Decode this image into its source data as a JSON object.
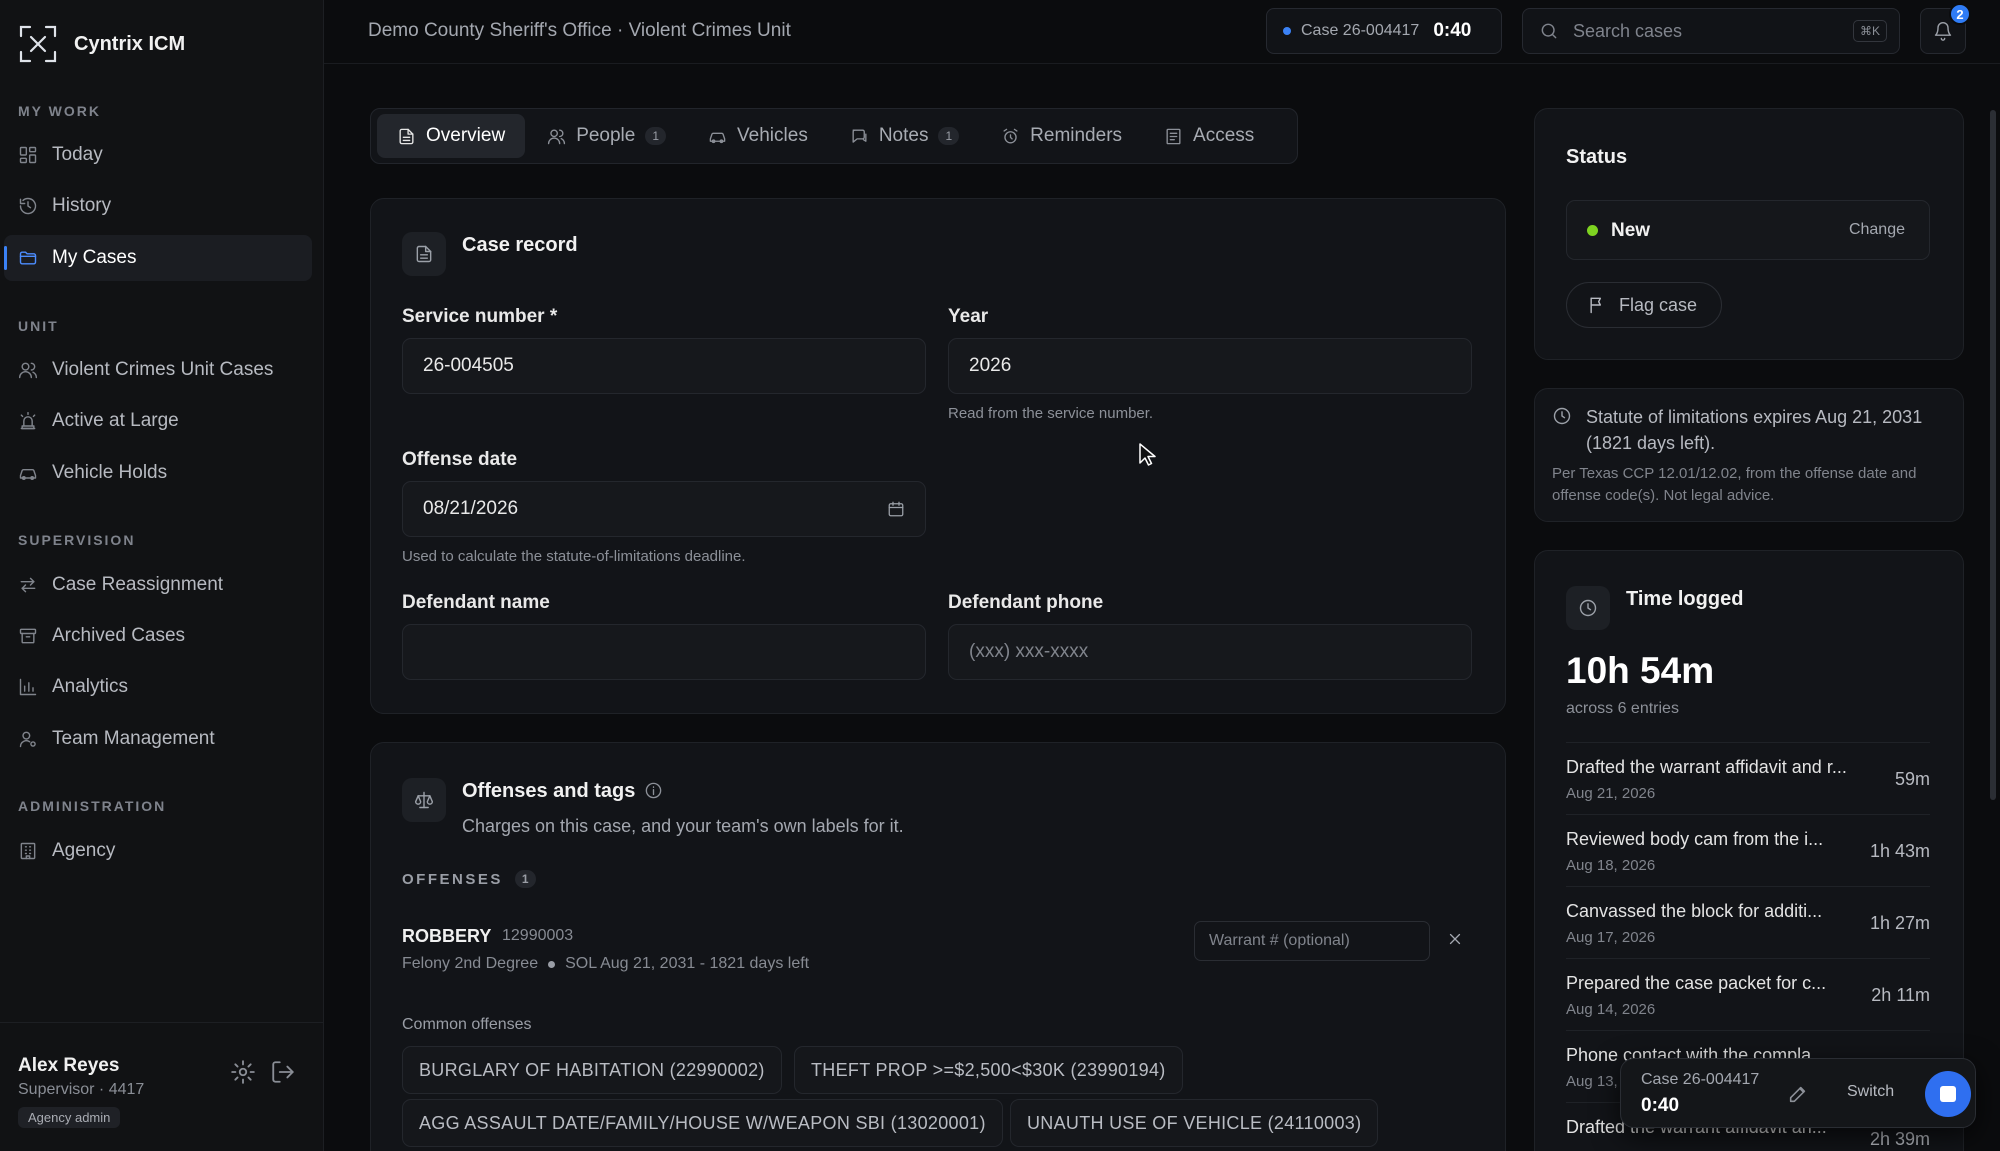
{
  "app": {
    "name": "Cyntrix ICM"
  },
  "sidebar": {
    "sections": {
      "my_work": "MY WORK",
      "unit": "UNIT",
      "supervision": "SUPERVISION",
      "administration": "ADMINISTRATION"
    },
    "items": [
      {
        "label": "Today",
        "icon": "grid-icon"
      },
      {
        "label": "History",
        "icon": "history-icon"
      },
      {
        "label": "My Cases",
        "icon": "folder-icon",
        "active": true
      },
      {
        "label": "Violent Crimes Unit Cases",
        "icon": "users-icon"
      },
      {
        "label": "Active at Large",
        "icon": "siren-icon"
      },
      {
        "label": "Vehicle Holds",
        "icon": "car-icon"
      },
      {
        "label": "Case Reassignment",
        "icon": "swap-icon"
      },
      {
        "label": "Archived Cases",
        "icon": "archive-icon"
      },
      {
        "label": "Analytics",
        "icon": "bar-chart-icon"
      },
      {
        "label": "Team Management",
        "icon": "user-gear-icon"
      },
      {
        "label": "Agency",
        "icon": "building-icon"
      }
    ],
    "user": {
      "name": "Alex Reyes",
      "role": "Supervisor · 4417",
      "badge": "Agency admin"
    }
  },
  "header": {
    "org": "Demo County Sheriff's Office · Violent Crimes Unit",
    "case_id": "Case 26-004417",
    "timer": "0:40",
    "search_placeholder": "Search cases",
    "search_shortcut": "⌘K",
    "notifications": "2"
  },
  "tabs": [
    {
      "label": "Overview",
      "icon": "document-icon",
      "active": true
    },
    {
      "label": "People",
      "icon": "people-icon",
      "count": "1"
    },
    {
      "label": "Vehicles",
      "icon": "car-icon"
    },
    {
      "label": "Notes",
      "icon": "chat-icon",
      "count": "1"
    },
    {
      "label": "Reminders",
      "icon": "alarm-icon"
    },
    {
      "label": "Access",
      "icon": "key-list-icon"
    }
  ],
  "case_record": {
    "title": "Case record",
    "service_number": {
      "label": "Service number *",
      "value": "26-004505"
    },
    "year": {
      "label": "Year",
      "value": "2026",
      "hint": "Read from the service number."
    },
    "offense_date": {
      "label": "Offense date",
      "value": "08/21/2026",
      "hint": "Used to calculate the statute-of-limitations deadline."
    },
    "defendant_name": {
      "label": "Defendant name",
      "value": ""
    },
    "defendant_phone": {
      "label": "Defendant phone",
      "placeholder": "(xxx) xxx-xxxx"
    }
  },
  "offenses": {
    "title": "Offenses and tags",
    "subtitle": "Charges on this case, and your team's own labels for it.",
    "section_label": "OFFENSES",
    "count": "1",
    "item": {
      "name": "ROBBERY",
      "code": "12990003",
      "degree": "Felony 2nd Degree",
      "sol": "SOL Aug 21, 2031 - 1821 days left",
      "warrant_placeholder": "Warrant # (optional)"
    },
    "common_label": "Common offenses",
    "common": [
      "BURGLARY OF HABITATION (22990002)",
      "THEFT PROP >=$2,500<$30K (23990194)",
      "AGG ASSAULT DATE/FAMILY/HOUSE W/WEAPON SBI (13020001)",
      "UNAUTH USE OF VEHICLE (24110003)"
    ]
  },
  "status": {
    "title": "Status",
    "value": "New",
    "change_label": "Change",
    "flag_label": "Flag case",
    "dot_color": "#7ed321"
  },
  "sol": {
    "main": "Statute of limitations expires Aug 21, 2031 (1821 days left).",
    "note": "Per Texas CCP 12.01/12.02, from the offense date and offense code(s). Not legal advice."
  },
  "time_logged": {
    "title": "Time logged",
    "total": "10h 54m",
    "sub": "across 6 entries",
    "entries": [
      {
        "desc": "Drafted the warrant affidavit and r...",
        "date": "Aug 21, 2026",
        "dur": "59m"
      },
      {
        "desc": "Reviewed body cam from the i...",
        "date": "Aug 18, 2026",
        "dur": "1h 43m"
      },
      {
        "desc": "Canvassed the block for additi...",
        "date": "Aug 17, 2026",
        "dur": "1h 27m"
      },
      {
        "desc": "Prepared the case packet for c...",
        "date": "Aug 14, 2026",
        "dur": "2h 11m"
      },
      {
        "desc": "Phone contact with the compla...",
        "date": "Aug 13,",
        "dur": ""
      },
      {
        "desc": "Drafted the warrant affidavit an...",
        "date": "",
        "dur": "2h 39m"
      }
    ]
  },
  "float_timer": {
    "case_id": "Case 26-004417",
    "time": "0:40",
    "switch_label": "Switch"
  },
  "colors": {
    "accent": "#3b82f6",
    "background": "#0b0c0e",
    "surface": "#121418"
  }
}
